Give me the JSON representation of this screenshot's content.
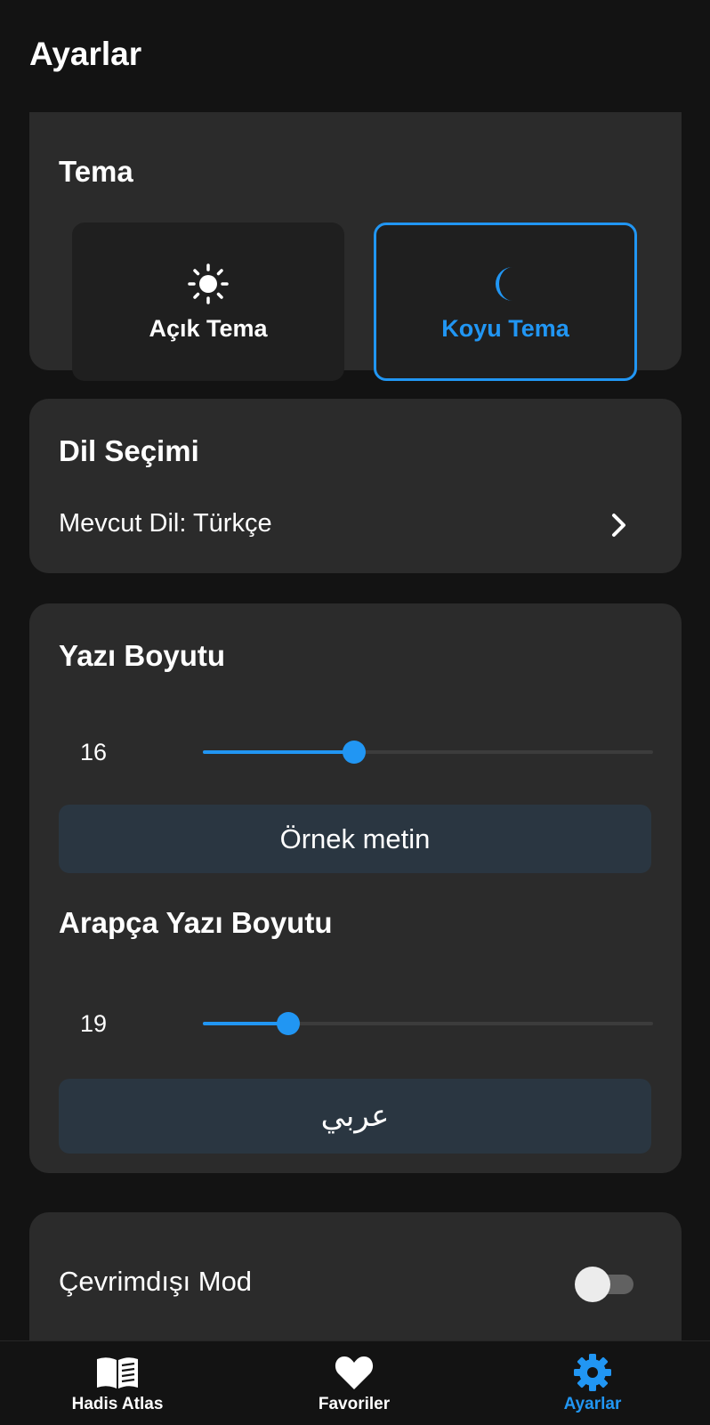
{
  "app_bar": {
    "title": "Ayarlar"
  },
  "theme": {
    "title": "Tema",
    "options": [
      {
        "label": "Açık Tema",
        "icon": "sun-icon",
        "selected": false
      },
      {
        "label": "Koyu Tema",
        "icon": "moon-icon",
        "selected": true
      }
    ]
  },
  "language": {
    "title": "Dil Seçimi",
    "current": "Mevcut Dil: Türkçe"
  },
  "font_size": {
    "title": "Yazı Boyutu",
    "value": "16",
    "slider_fraction": 0.335,
    "preview": "Örnek metin"
  },
  "arabic_font_size": {
    "title": "Arapça Yazı Boyutu",
    "value": "19",
    "slider_fraction": 0.19,
    "preview": "عربي"
  },
  "offline": {
    "label": "Çevrimdışı Mod",
    "enabled": false
  },
  "bottom_nav": {
    "items": [
      {
        "label": "Hadis Atlas",
        "icon": "book-icon",
        "active": false
      },
      {
        "label": "Favoriler",
        "icon": "heart-icon",
        "active": false
      },
      {
        "label": "Ayarlar",
        "icon": "gear-icon",
        "active": true
      }
    ]
  },
  "colors": {
    "accent": "#2196f3",
    "background": "#131313",
    "card": "#2b2b2b",
    "preview_box": "#2a3641"
  }
}
